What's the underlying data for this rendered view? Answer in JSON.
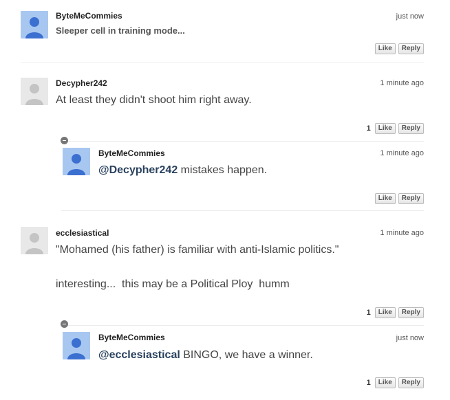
{
  "colors": {
    "link": "#29415e",
    "avatar_blue": "#a8c7f0",
    "avatar_gray": "#e8e8e8"
  },
  "buttons": {
    "like": "Like",
    "reply": "Reply"
  },
  "comments": [
    {
      "author": "ByteMeCommies",
      "time": "just now",
      "text": "Sleeper cell in training mode...",
      "likes": "",
      "avatar": "person-icon-blue"
    },
    {
      "author": "Decypher242",
      "time": "1 minute ago",
      "text": "At least they didn't shoot him right away.",
      "likes": "1",
      "avatar": "person-icon-gray"
    },
    {
      "author": "ByteMeCommies",
      "time": "1 minute ago",
      "mention": "@Decypher242",
      "text": " mistakes happen.",
      "likes": "",
      "avatar": "person-icon-blue"
    },
    {
      "author": "ecclesiastical",
      "time": "1 minute ago",
      "text_line1": "\"Mohamed (his father) is familiar with anti-Islamic politics.\"",
      "text_line2": "interesting...  this may be a Political Ploy  humm",
      "likes": "1",
      "avatar": "person-icon-gray"
    },
    {
      "author": "ByteMeCommies",
      "time": "just now",
      "mention": "@ecclesiastical",
      "text": " BINGO, we have a winner.",
      "likes": "1",
      "avatar": "person-icon-blue"
    }
  ]
}
